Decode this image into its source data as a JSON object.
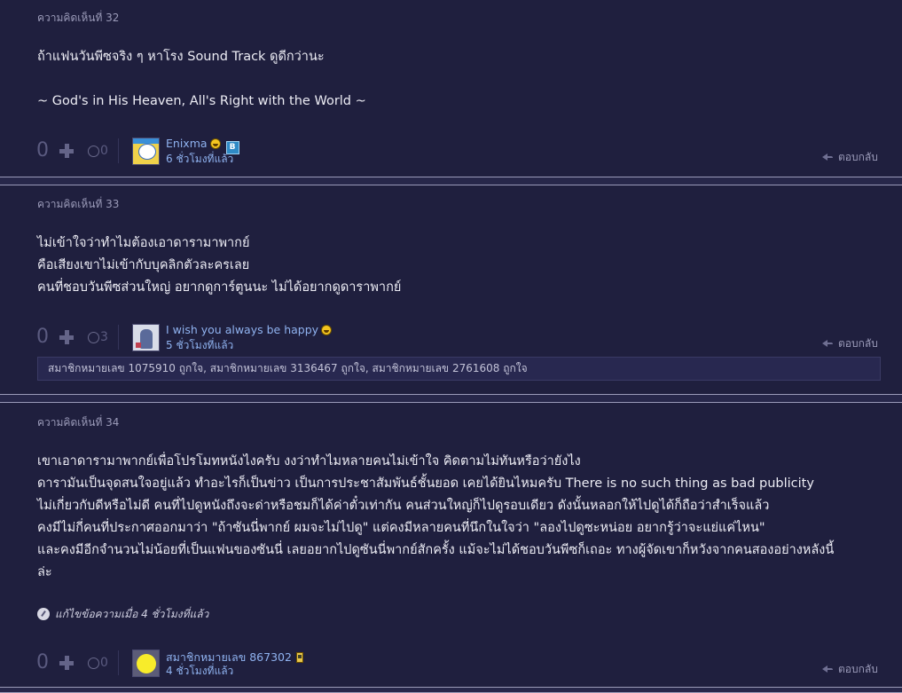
{
  "comments": [
    {
      "number_label": "ความคิดเห็นที่ 32",
      "lines": [
        "ถ้าแฟนวันพีซจริง ๆ หาโรง Sound Track ดูดีกว่านะ",
        "",
        "~ God's in His Heaven, All's Right with the World ~"
      ],
      "vote_count": "0",
      "emotion_count": "0",
      "author": "Enixma",
      "time": "6 ชั่วโมงที่แล้ว",
      "reply_label": "ตอบกลับ"
    },
    {
      "number_label": "ความคิดเห็นที่ 33",
      "lines": [
        "ไม่เข้าใจว่าทำไมต้องเอาดารามาพากย์",
        "คือเสียงเขาไม่เข้ากับบุคลิกตัวละครเลย",
        "คนที่ชอบวันพีซส่วนใหญ่ อยากดูการ์ตูนนะ ไม่ได้อยากดูดาราพากย์"
      ],
      "vote_count": "0",
      "emotion_count": "3",
      "author": "I wish you always be happy",
      "time": "5 ชั่วโมงที่แล้ว",
      "reply_label": "ตอบกลับ",
      "likes_text": "สมาชิกหมายเลข 1075910 ถูกใจ, สมาชิกหมายเลข 3136467 ถูกใจ, สมาชิกหมายเลข 2761608 ถูกใจ"
    },
    {
      "number_label": "ความคิดเห็นที่ 34",
      "lines": [
        "เขาเอาดารามาพากย์เพื่อโปรโมทหนังไงครับ งงว่าทำไมหลายคนไม่เข้าใจ คิดตามไม่ทันหรือว่ายังไง",
        "ดารามันเป็นจุดสนใจอยู่แล้ว ทำอะไรก็เป็นข่าว เป็นการประชาสัมพันธ์ชั้นยอด เคยได้ยินไหมครับ There is no such thing as bad publicity",
        "ไม่เกี่ยวกับดีหรือไม่ดี คนที่ไปดูหนังถึงจะด่าหรือชมก็ได้ค่าตั๋วเท่ากัน คนส่วนใหญ่ก็ไปดูรอบเดียว ดังนั้นหลอกให้ไปดูได้ก็ถือว่าสำเร็จแล้ว",
        "คงมีไม่กี่คนที่ประกาศออกมาว่า \"ถ้าซันนี่พากย์ ผมจะไม่ไปดู\" แต่คงมีหลายคนที่นึกในใจว่า \"ลองไปดูซะหน่อย อยากรู้ว่าจะแย่แค่ไหน\"",
        "และคงมีอีกจำนวนไม่น้อยที่เป็นแฟนของซันนี่ เลยอยากไปดูซันนี่พากย์สักครั้ง แม้จะไม่ได้ชอบวันพีซก็เถอะ ทางผู้จัดเขาก็หวังจากคนสองอย่างหลังนี้",
        "ล่ะ"
      ],
      "edit_note": "แก้ไขข้อความเมื่อ 4 ชั่วโมงที่แล้ว",
      "vote_count": "0",
      "emotion_count": "0",
      "author": "สมาชิกหมายเลข 867302",
      "time": "4 ชั่วโมงที่แล้ว",
      "reply_label": "ตอบกลับ"
    }
  ]
}
